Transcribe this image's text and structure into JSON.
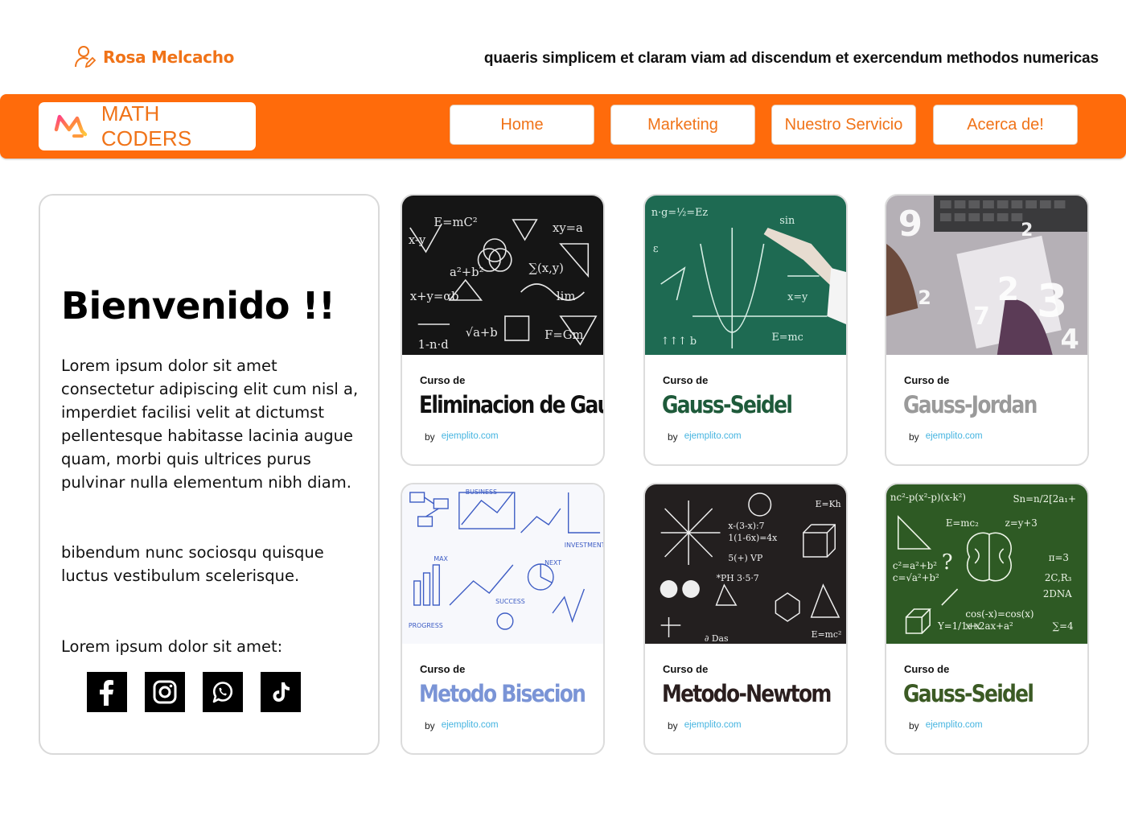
{
  "user": {
    "name": "Rosa Melcacho",
    "icon": "user-edit-icon"
  },
  "tagline": "quaeris simplicem et claram viam ad discendum et exercendum methodos numericas",
  "brand": {
    "name": "MATH CODERS",
    "logo": "m-logo-icon"
  },
  "nav": [
    "Home",
    "Marketing",
    "Nuestro Servicio",
    "Acerca de!"
  ],
  "colors": {
    "accent": "#ff6b0b",
    "accent_text": "#f07318",
    "link": "#45b4e0"
  },
  "welcome": {
    "title": "Bienvenido !!",
    "paragraph1": "Lorem ipsum dolor sit amet consectetur adipiscing elit cum nisl a, imperdiet facilisi velit at dictumst pellentesque habitasse lacinia augue quam, morbi quis ultrices purus pulvinar nulla elementum nibh diam.",
    "paragraph2": "bibendum nunc sociosqu quisque luctus vestibulum scelerisque.",
    "paragraph3": "Lorem ipsum dolor sit amet:",
    "socials": [
      "facebook-icon",
      "instagram-icon",
      "whatsapp-icon",
      "tiktok-icon"
    ]
  },
  "courses": [
    {
      "kicker": "Curso de",
      "title": "Eliminacion de Gauss",
      "by": "by",
      "link": "ejemplito.com",
      "title_color": "#111111",
      "image": "blackboard-formulas"
    },
    {
      "kicker": "Curso de",
      "title": "Gauss-Seidel",
      "by": "by",
      "link": "ejemplito.com",
      "title_color": "#1e5a3a",
      "image": "green-chalkboard-graph"
    },
    {
      "kicker": "Curso de",
      "title": "Gauss-Jordan",
      "by": "by",
      "link": "ejemplito.com",
      "title_color": "#9a9a9a",
      "image": "desk-numbers"
    },
    {
      "kicker": "Curso de",
      "title": "Metodo Bisecion",
      "by": "by",
      "link": "ejemplito.com",
      "title_color": "#7a94d6",
      "image": "sketch-charts"
    },
    {
      "kicker": "Curso de",
      "title": "Metodo-Newtom",
      "by": "by",
      "link": "ejemplito.com",
      "title_color": "#2a1e1e",
      "image": "dark-chalkboard-science"
    },
    {
      "kicker": "Curso de",
      "title": "Gauss-Seidel",
      "by": "by",
      "link": "ejemplito.com",
      "title_color": "#3b5a24",
      "image": "green-chalkboard-brain"
    }
  ]
}
